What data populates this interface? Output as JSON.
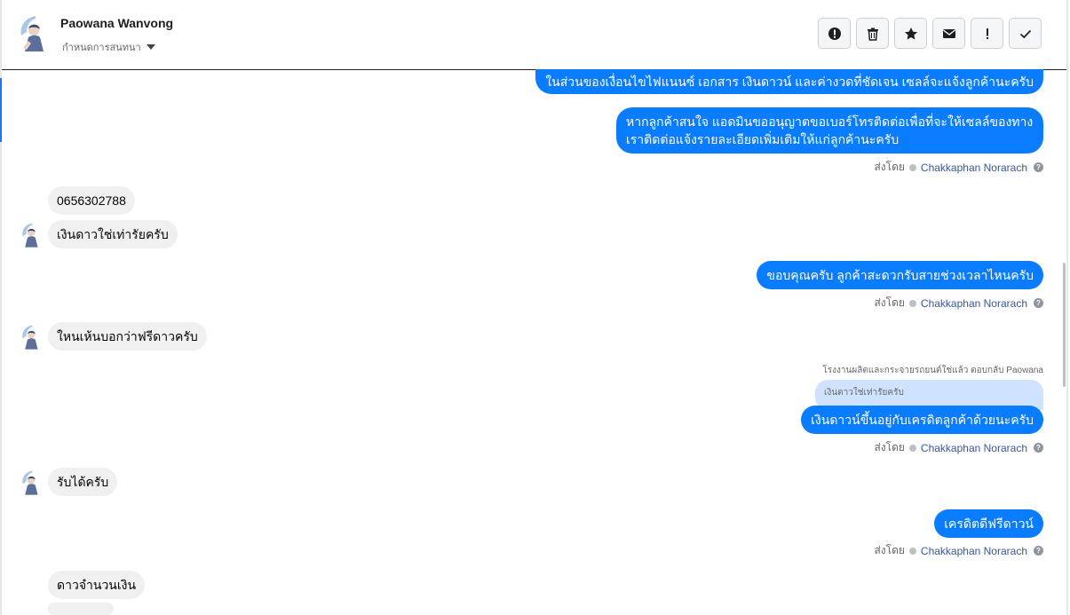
{
  "header": {
    "contact_name": "Paowana Wanvong",
    "status_label": "กำหนดการสนทนา",
    "toolbar_icons": [
      "spam-icon",
      "trash-icon",
      "star-icon",
      "envelope-icon",
      "exclamation-icon",
      "check-icon"
    ]
  },
  "messages": [
    {
      "side": "out",
      "text": "ในส่วนของเงื่อนไขไฟแนนซ์ เอกสาร เงินดาวน์ และค่างวดที่ชัดเจน เซลล์จะแจ้งลูกค้านะครับ"
    },
    {
      "side": "out",
      "text": "หากลูกค้าสนใจ แอดมินขออนุญาตขอเบอร์โทรติดต่อเพื่อที่จะให้เซลล์ของทางเราติดต่อแจ้งรายละเอียดเพิ่มเติมให้แก่ลูกค้านะครับ"
    },
    {
      "side": "in",
      "text": "0656302788"
    },
    {
      "side": "in",
      "text": "เงินดาวใช่เท่ารัยครับ"
    },
    {
      "side": "out",
      "text": "ขอบคุณครับ ลูกค้าสะดวกรับสายช่วงเวลาไหนครับ"
    },
    {
      "side": "in",
      "text": "ใหนเห้นบอกว่าฟรีดาวครับ"
    },
    {
      "side": "out",
      "text": "เงินดาวน์ขึ้นอยู่กับเครดิตลูกค้าด้วยนะครับ"
    },
    {
      "side": "in",
      "text": "รับได้ครับ"
    },
    {
      "side": "out",
      "text": "เครดิตดีฟรีดาวน์"
    },
    {
      "side": "in",
      "text": "ดาวจำนวนเงิน"
    }
  ],
  "sent_by": {
    "label": "ส่งโดย",
    "agent": "Chakkaphan Norarach"
  },
  "reply": {
    "note": "โรงงานผลิตและกระจายรถยนต์ใช่แล้ว ตอบกลับ Paowana",
    "quoted_text": "เงินดาวใช่เท่ารัยครับ"
  },
  "colors": {
    "outgoing_bubble": "#0a7cff",
    "incoming_bubble": "#f0f0f0",
    "quote_bubble": "#cfe3ff",
    "agent_link": "#385898"
  }
}
